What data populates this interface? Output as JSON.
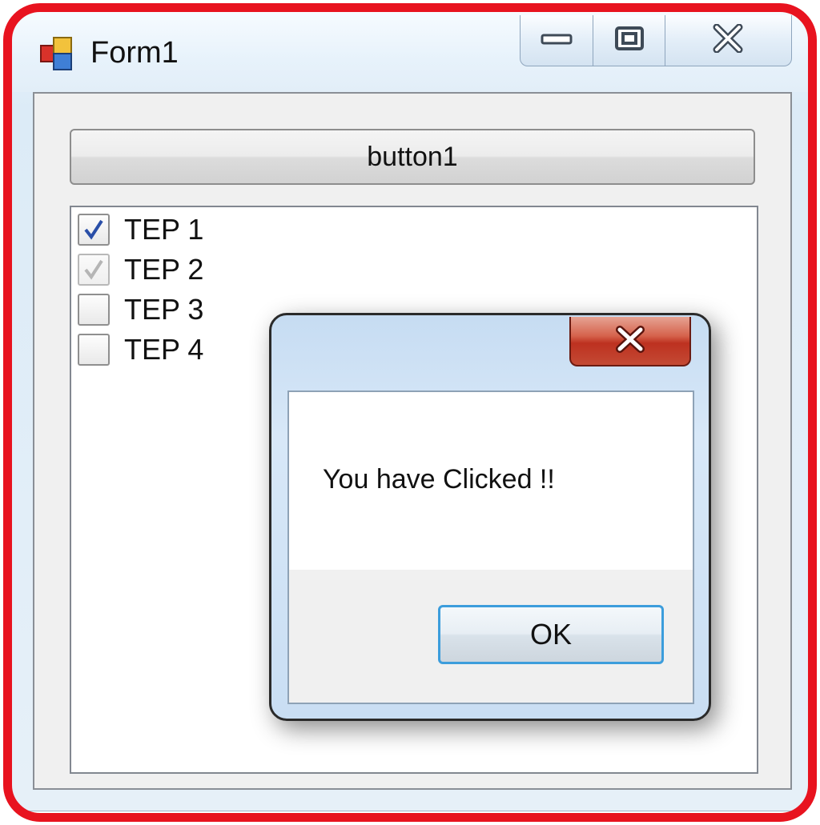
{
  "window": {
    "title": "Form1"
  },
  "form": {
    "button1_label": "button1",
    "checklist": [
      {
        "label": "TEP 1",
        "checked": true,
        "enabled": true
      },
      {
        "label": "TEP 2",
        "checked": true,
        "enabled": false
      },
      {
        "label": "TEP 3",
        "checked": false,
        "enabled": true
      },
      {
        "label": "TEP 4",
        "checked": false,
        "enabled": true
      }
    ]
  },
  "messagebox": {
    "text": "You have Clicked !!",
    "ok_label": "OK"
  },
  "colors": {
    "highlight": "#e8131f",
    "check_mark": "#2a4fa8",
    "check_mark_disabled": "#b5b5b5",
    "ok_focus_border": "#3c9ddc"
  }
}
